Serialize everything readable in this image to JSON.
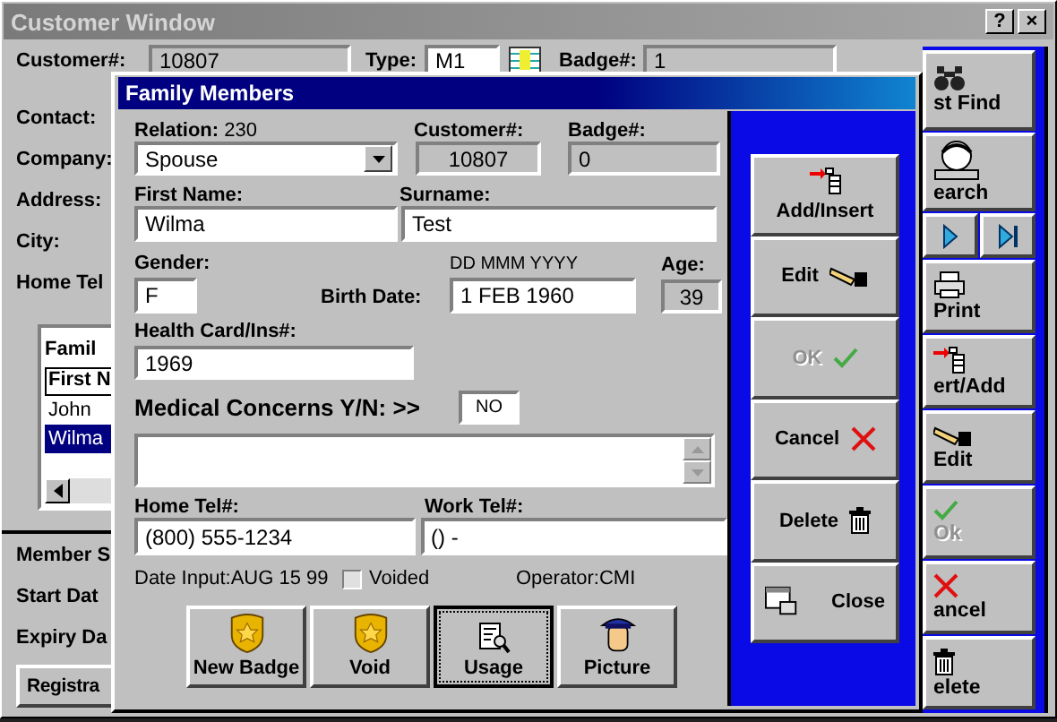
{
  "customer_window": {
    "title": "Customer Window",
    "title_buttons": [
      "?",
      "×"
    ],
    "header_fields": [
      {
        "label": "Customer#:",
        "value": "10807"
      },
      {
        "label": "Type:",
        "value": "M1"
      },
      {
        "label": "Badge#:",
        "value": "1"
      }
    ],
    "labels": [
      "Contact:",
      "Company:",
      "Address:",
      "City:",
      "Home Tel"
    ],
    "family_list": {
      "title": "Famil",
      "column": "First N",
      "rows": [
        {
          "text": "John",
          "selected": false
        },
        {
          "text": "Wilma",
          "selected": true
        }
      ]
    },
    "lower_labels": [
      "Member S",
      "Start Dat",
      "Expiry Da"
    ],
    "registration_button": "Registra",
    "toolbar": [
      {
        "kind": "find",
        "label": "st Find",
        "disabled": false
      },
      {
        "kind": "search",
        "label": "earch",
        "disabled": false
      },
      {
        "kind": "nav"
      },
      {
        "kind": "print",
        "label": "Print",
        "disabled": false
      },
      {
        "kind": "insert",
        "label": "ert/Add",
        "disabled": false
      },
      {
        "kind": "edit",
        "label": "Edit",
        "disabled": false
      },
      {
        "kind": "ok",
        "label": "Ok",
        "disabled": true
      },
      {
        "kind": "cancel",
        "label": "ancel",
        "disabled": false
      },
      {
        "kind": "delete",
        "label": "elete",
        "disabled": false
      }
    ]
  },
  "dialog": {
    "title": "Family Members",
    "relation": {
      "label": "Relation:",
      "code": "230",
      "value": "Spouse"
    },
    "customer": {
      "label": "Customer#:",
      "value": "10807"
    },
    "badge": {
      "label": "Badge#:",
      "value": "0"
    },
    "first_name": {
      "label": "First Name:",
      "value": "Wilma"
    },
    "surname": {
      "label": "Surname:",
      "value": "Test"
    },
    "gender": {
      "label": "Gender:",
      "value": "F"
    },
    "birth_date": {
      "label": "Birth Date:",
      "format": "DD  MMM  YYYY",
      "value": "1 FEB 1960"
    },
    "age": {
      "label": "Age:",
      "value": "39"
    },
    "health_card": {
      "label": "Health Card/Ins#:",
      "value": "1969"
    },
    "medical": {
      "label": "Medical Concerns Y/N: >>",
      "value": "NO"
    },
    "home_tel": {
      "label": "Home Tel#:",
      "value": "(800) 555-1234"
    },
    "work_tel": {
      "label": "Work Tel#:",
      "value": "() -"
    },
    "date_input": "Date Input:AUG 15 99",
    "voided": {
      "label": "Voided",
      "checked": false
    },
    "operator": "Operator:CMI",
    "bottom_buttons": [
      {
        "kind": "badge",
        "label": "New Badge",
        "focused": false
      },
      {
        "kind": "void",
        "label": "Void",
        "focused": false
      },
      {
        "kind": "usage",
        "label": "Usage",
        "focused": true
      },
      {
        "kind": "picture",
        "label": "Picture",
        "focused": false
      }
    ],
    "side_buttons": [
      {
        "kind": "insert",
        "label": "Add/Insert",
        "disabled": false
      },
      {
        "kind": "edit",
        "label": "Edit",
        "disabled": false
      },
      {
        "kind": "ok",
        "label": "OK",
        "disabled": true
      },
      {
        "kind": "cancel",
        "label": "Cancel",
        "disabled": false
      },
      {
        "kind": "delete",
        "label": "Delete",
        "disabled": false
      },
      {
        "kind": "close",
        "label": "Close",
        "disabled": false
      }
    ]
  }
}
